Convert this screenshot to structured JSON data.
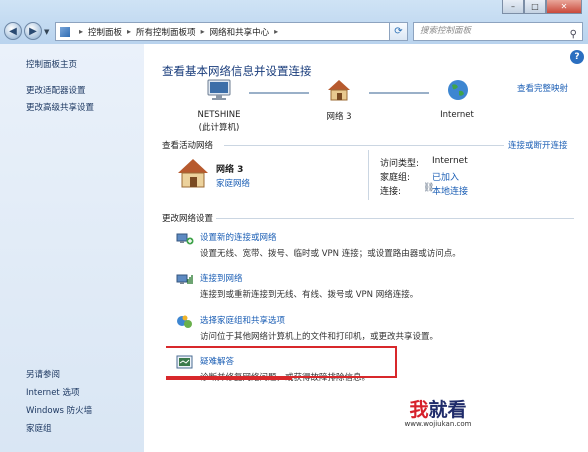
{
  "address": {
    "crumbs": [
      "控制面板",
      "所有控制面板项",
      "网络和共享中心"
    ],
    "search_placeholder": "搜索控制面板"
  },
  "window": {
    "minimize": "–",
    "maximize": "□",
    "close": "✕"
  },
  "sidebar": {
    "items": [
      "控制面板主页",
      "更改适配器设置",
      "更改高级共享设置"
    ],
    "see_also_title": "另请参阅",
    "see_also": [
      "Internet 选项",
      "Windows 防火墙",
      "家庭组"
    ]
  },
  "main": {
    "heading": "查看基本网络信息并设置连接",
    "view_full_map": "查看完整映射",
    "map": {
      "computer_name": "NETSHINE",
      "computer_sub": "(此计算机)",
      "network": "网络  3",
      "internet": "Internet"
    },
    "active_section": {
      "title": "查看活动网络",
      "connect_link": "连接或断开连接",
      "network_name": "网络  3",
      "network_type": "家庭网络",
      "access_type_label": "访问类型:",
      "access_type_value": "Internet",
      "homegroup_label": "家庭组:",
      "homegroup_value": "已加入",
      "connections_label": "连接:",
      "connections_value": "本地连接"
    },
    "change_section": {
      "title": "更改网络设置",
      "items": [
        {
          "title": "设置新的连接或网络",
          "desc": "设置无线、宽带、拨号、临时或 VPN 连接；或设置路由器或访问点。"
        },
        {
          "title": "连接到网络",
          "desc": "连接到或重新连接到无线、有线、拨号或 VPN 网络连接。"
        },
        {
          "title": "选择家庭组和共享选项",
          "desc": "访问位于其他网络计算机上的文件和打印机，或更改共享设置。"
        },
        {
          "title": "疑难解答",
          "desc": "诊断并修复网络问题，或获得故障排除信息。"
        }
      ]
    }
  },
  "watermark": {
    "brand_red": "我",
    "brand_rest": "就看",
    "url": "www.wojiukan.com"
  },
  "colors": {
    "link": "#1c5fb5",
    "highlight": "#d8282b",
    "heading": "#1a3d7c"
  }
}
